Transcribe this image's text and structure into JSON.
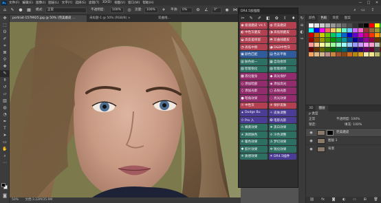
{
  "menubar": {
    "logo": "Ps",
    "items": [
      "文件(F)",
      "编辑(E)",
      "图像(I)",
      "图层(L)",
      "文字(Y)",
      "选择(S)",
      "滤镜(T)",
      "3D(D)",
      "视图(V)",
      "窗口(W)",
      "帮助(H)"
    ],
    "controls": [
      "—",
      "□",
      "✕"
    ]
  },
  "options": {
    "mode_label": "模式:",
    "mode_value": "正常",
    "opacity_label": "不透明度:",
    "opacity_value": "100%",
    "flow_label": "流量:",
    "flow_value": "100%",
    "smooth_label": "平滑:",
    "smooth_value": "0%",
    "angle_value": "0°"
  },
  "document": {
    "tabs": [
      "portrait-1579925.jpg @ 50% (完美磨皮 ...",
      "未标题-1 @ 50% (RGB/8) ×",
      "双曲线..."
    ],
    "zoom": "50%",
    "doc_size": "文档:3.22M/35.9M"
  },
  "plugin": {
    "title": "DR4.5加强版",
    "toolbar_icons": [
      "✂",
      "✎",
      "✐",
      "◧",
      "✿",
      "⇪",
      "♦"
    ],
    "buttons": [
      {
        "label": "极速磨皮 V4.5",
        "icon": "◉",
        "color": "red"
      },
      {
        "label": "完美磨皮",
        "icon": "◍",
        "color": "red"
      },
      {
        "label": "中性灰磨皮",
        "icon": "◐",
        "color": "red"
      },
      {
        "label": "高低频磨皮",
        "icon": "◑",
        "color": "red"
      },
      {
        "label": "高反差保留",
        "icon": "◒",
        "color": "red"
      },
      {
        "label": "双曲线磨皮",
        "icon": "◓",
        "color": "red"
      },
      {
        "label": "高低中频",
        "icon": "◔",
        "color": "red"
      },
      {
        "label": "D&B中性灰",
        "icon": "◕",
        "color": "red"
      },
      {
        "label": "颜色匹配",
        "icon": "▣",
        "color": "blue"
      },
      {
        "label": "色彩平衡",
        "icon": "▤",
        "color": "blue"
      },
      {
        "label": "肤色统一",
        "icon": "▥",
        "color": "teal"
      },
      {
        "label": "自动修饰",
        "icon": "▦",
        "color": "teal"
      },
      {
        "label": "智能锐化",
        "icon": "▧",
        "color": "teal"
      },
      {
        "label": "智能修饰",
        "icon": "▨",
        "color": "teal"
      },
      {
        "label": "液化瘦身",
        "icon": "▩",
        "color": "magenta"
      },
      {
        "label": "高光保护",
        "icon": "◆",
        "color": "magenta"
      },
      {
        "label": "添加暗部",
        "icon": "◇",
        "color": "magenta"
      },
      {
        "label": "添加高光",
        "icon": "◈",
        "color": "magenta"
      },
      {
        "label": "添加光影",
        "icon": "◊",
        "color": "magenta"
      },
      {
        "label": "去除光影",
        "icon": "○",
        "color": "magenta"
      },
      {
        "label": "暗角效果",
        "icon": "●",
        "color": "magenta"
      },
      {
        "label": "亮光效果",
        "icon": "◌",
        "color": "magenta"
      },
      {
        "label": "中性灰",
        "icon": "☼",
        "color": "red"
      },
      {
        "label": "保护皮肤",
        "icon": "☀",
        "color": "red"
      },
      {
        "label": "Dodge Bu",
        "icon": "✦",
        "color": "purple"
      },
      {
        "label": "皮肤调整",
        "icon": "✧",
        "color": "purple"
      },
      {
        "label": "Pro 入",
        "icon": "✩",
        "color": "purple"
      },
      {
        "label": "电影光影",
        "icon": "✪",
        "color": "purple"
      },
      {
        "label": "橘黄效果",
        "icon": "✫",
        "color": "teal"
      },
      {
        "label": "黑白效果",
        "icon": "✬",
        "color": "teal"
      },
      {
        "label": "清新肤色",
        "icon": "✭",
        "color": "teal"
      },
      {
        "label": "冷色调整",
        "icon": "✮",
        "color": "teal"
      },
      {
        "label": "暖色效果",
        "icon": "✯",
        "color": "teal"
      },
      {
        "label": "梦幻效果",
        "icon": "✰",
        "color": "teal"
      },
      {
        "label": "胶片效果",
        "icon": "✱",
        "color": "teal"
      },
      {
        "label": "锐化效果",
        "icon": "✲",
        "color": "teal"
      },
      {
        "label": "质感效果",
        "icon": "✳",
        "color": "teal"
      },
      {
        "label": "DR4.5插件",
        "icon": "✴",
        "color": "purple"
      }
    ]
  },
  "swatches": {
    "tabs": [
      "颜色",
      "色板",
      "渐变",
      "图案"
    ],
    "colors": [
      "#ffffff",
      "#e6e6e6",
      "#cccccc",
      "#b3b3b3",
      "#999999",
      "#808080",
      "#666666",
      "#4d4d4d",
      "#333333",
      "#1a1a1a",
      "#000000",
      "#ff0000",
      "#ffff00",
      "#00ff00",
      "#00ffff",
      "#0000ff",
      "#ff00ff",
      "#ff6666",
      "#ffcc66",
      "#ccff66",
      "#66ffcc",
      "#66ccff",
      "#cc66ff",
      "#ff66cc",
      "#993333",
      "#996633",
      "#999933",
      "#339933",
      "#cc0000",
      "#cc6600",
      "#cccc00",
      "#66cc00",
      "#00cc66",
      "#00cccc",
      "#0066cc",
      "#0000cc",
      "#6600cc",
      "#cc00cc",
      "#cc0066",
      "#ff3300",
      "#ff9900",
      "#ffcc00",
      "#990000",
      "#994c00",
      "#999900",
      "#4c9900",
      "#009900",
      "#00994c",
      "#009999",
      "#004c99",
      "#000099",
      "#4c0099",
      "#990099",
      "#99004c",
      "#663300",
      "#333300",
      "#ff9999",
      "#ffcc99",
      "#ffff99",
      "#ccff99",
      "#99ff99",
      "#99ffcc",
      "#99ffff",
      "#99ccff",
      "#9999ff",
      "#cc99ff",
      "#ff99ff",
      "#ff99cc",
      "#c0c0c0",
      "#808000",
      "#660000",
      "#663300",
      "#666600",
      "#336600",
      "#006600",
      "#006633",
      "#006666",
      "#003366",
      "#000066",
      "#330066",
      "#660066",
      "#660033",
      "#404040",
      "#800000",
      "#f4a460",
      "#deb887",
      "#d2b48c",
      "#bc8f8f",
      "#cd853f",
      "#a0522d",
      "#8b4513",
      "#d2691e",
      "#b8860b",
      "#daa520",
      "#eee8aa",
      "#f0e68c",
      "#bdb76b",
      "#556b2f"
    ]
  },
  "layers": {
    "tabs": [
      "3D",
      "图层"
    ],
    "filter_label": "ρ 类型",
    "blend": "正常",
    "opacity": "不透明度: 100%",
    "lock": "锁定:",
    "fill": "填充: 100%",
    "items": [
      {
        "name": "完美磨皮",
        "active": true
      },
      {
        "name": "图层 1",
        "active": false
      },
      {
        "name": "背景",
        "active": false
      }
    ]
  }
}
